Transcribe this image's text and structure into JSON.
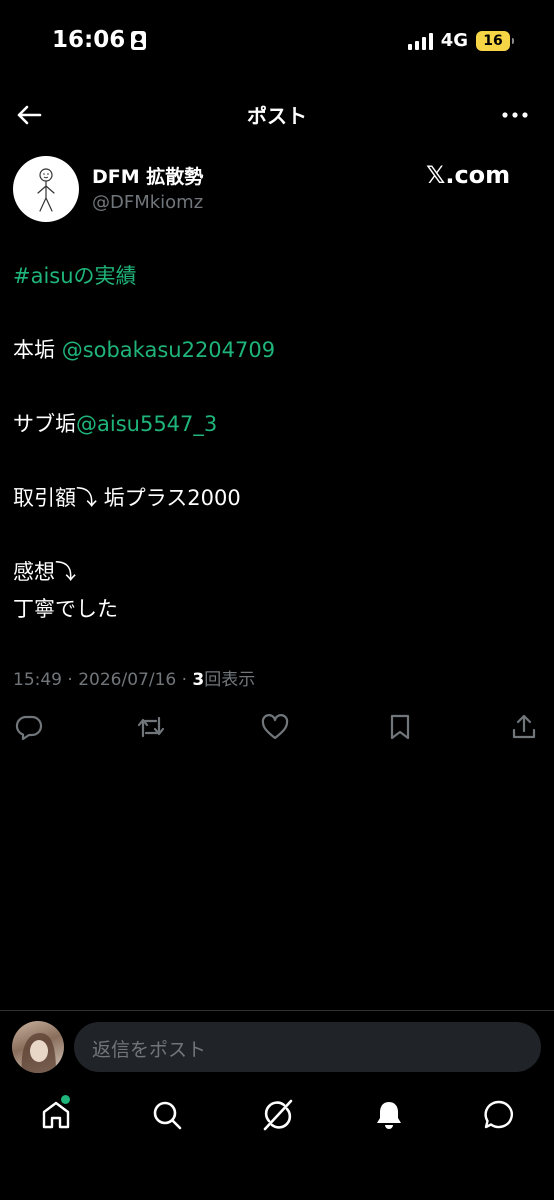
{
  "status": {
    "time": "16:06",
    "network": "4G",
    "battery": "16"
  },
  "header": {
    "title": "ポスト"
  },
  "author": {
    "name": "DFM 拡散勢",
    "handle": "@DFMkiomz"
  },
  "watermark": "𝕏.com",
  "post": {
    "line1": "#aisuの実績",
    "line2_prefix": "本垢 ",
    "line2_link": "@sobakasu2204709",
    "line3_prefix": "サブ垢",
    "line3_link": "@aisu5547_3",
    "line4": "取引額⤵︎ 垢プラス2000",
    "line5": "感想⤵︎",
    "line6": "丁寧でした"
  },
  "meta": {
    "time": "15:49",
    "date": "2026/07/16",
    "views_count": "3",
    "views_label": "回表示",
    "sep": "·"
  },
  "reply": {
    "placeholder": "返信をポスト"
  },
  "colors": {
    "accent": "#1fb57a",
    "muted": "#71767b",
    "battery": "#f5d546"
  },
  "icons": {
    "actions": [
      "reply-icon",
      "repost-icon",
      "like-icon",
      "bookmark-icon",
      "share-icon"
    ],
    "nav": [
      "home-icon",
      "search-icon",
      "grok-icon",
      "notifications-icon",
      "messages-icon"
    ]
  }
}
